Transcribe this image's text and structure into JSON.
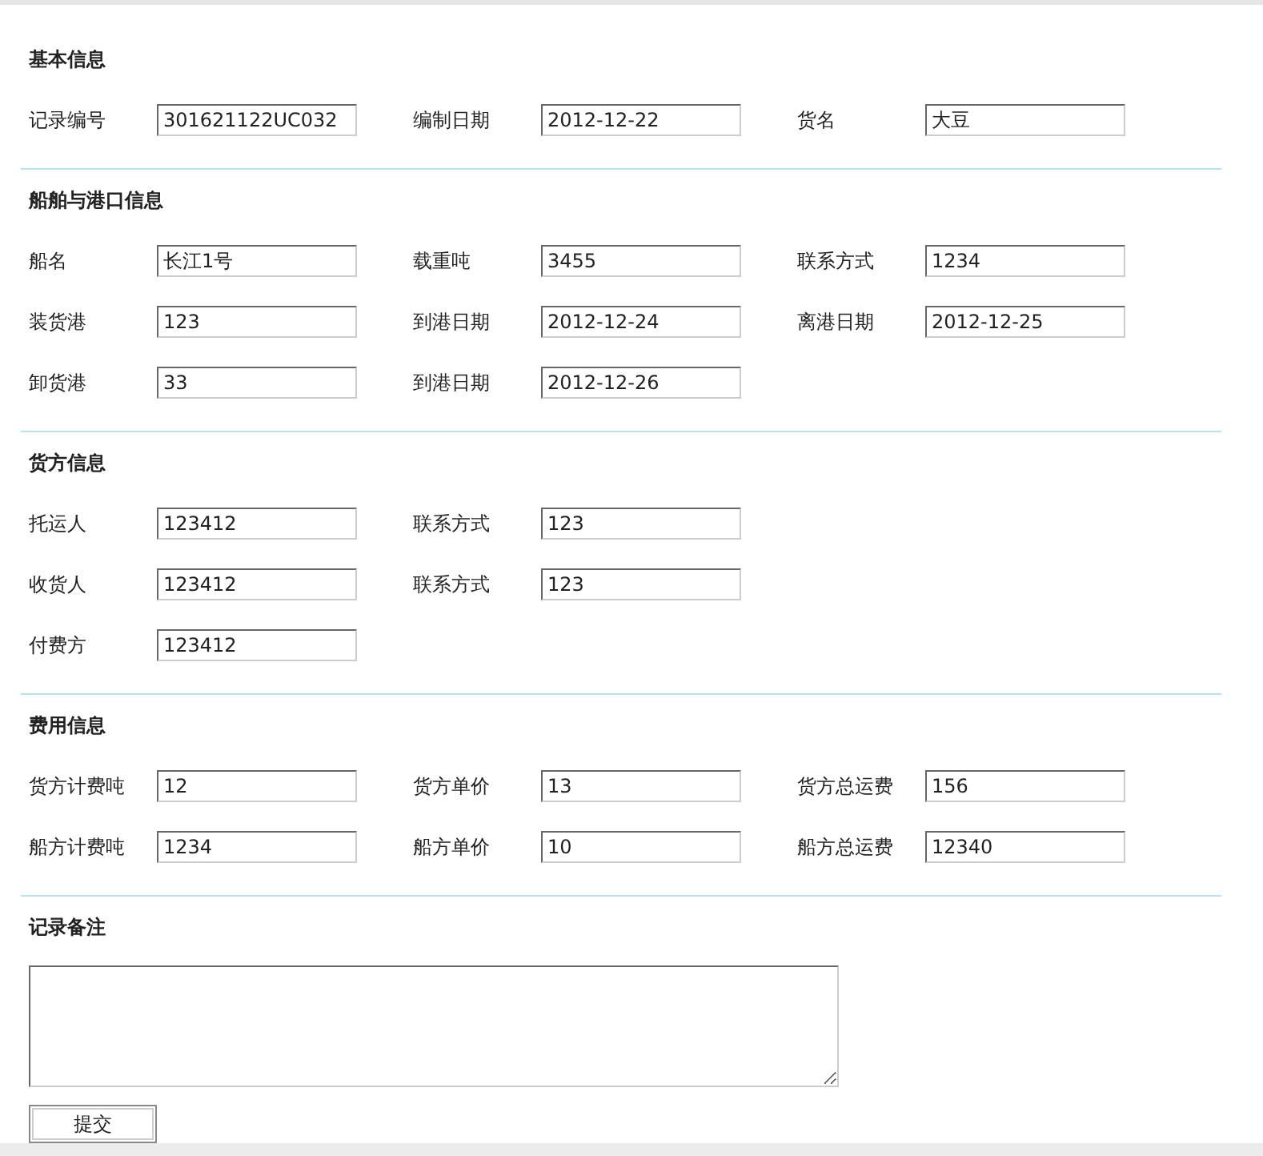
{
  "sections": [
    {
      "title": "基本信息",
      "rows": [
        [
          {
            "label": "记录编号",
            "value": "301621122UC032"
          },
          {
            "label": "编制日期",
            "value": "2012-12-22"
          },
          {
            "label": "货名",
            "value": "大豆"
          }
        ]
      ]
    },
    {
      "title": "船舶与港口信息",
      "rows": [
        [
          {
            "label": "船名",
            "value": "长江1号"
          },
          {
            "label": "载重吨",
            "value": "3455"
          },
          {
            "label": "联系方式",
            "value": "1234"
          }
        ],
        [
          {
            "label": "装货港",
            "value": "123"
          },
          {
            "label": "到港日期",
            "value": "2012-12-24"
          },
          {
            "label": "离港日期",
            "value": "2012-12-25"
          }
        ],
        [
          {
            "label": "卸货港",
            "value": "33"
          },
          {
            "label": "到港日期",
            "value": "2012-12-26"
          }
        ]
      ]
    },
    {
      "title": "货方信息",
      "rows": [
        [
          {
            "label": "托运人",
            "value": "123412"
          },
          {
            "label": "联系方式",
            "value": "123"
          }
        ],
        [
          {
            "label": "收货人",
            "value": "123412"
          },
          {
            "label": "联系方式",
            "value": "123"
          }
        ],
        [
          {
            "label": "付费方",
            "value": "123412"
          }
        ]
      ]
    },
    {
      "title": "费用信息",
      "rows": [
        [
          {
            "label": "货方计费吨",
            "value": "12"
          },
          {
            "label": "货方单价",
            "value": "13"
          },
          {
            "label": "货方总运费",
            "value": "156"
          }
        ],
        [
          {
            "label": "船方计费吨",
            "value": "1234"
          },
          {
            "label": "船方单价",
            "value": "10"
          },
          {
            "label": "船方总运费",
            "value": "12340"
          }
        ]
      ]
    }
  ],
  "remarks": {
    "title": "记录备注"
  },
  "submit_button": "提交"
}
